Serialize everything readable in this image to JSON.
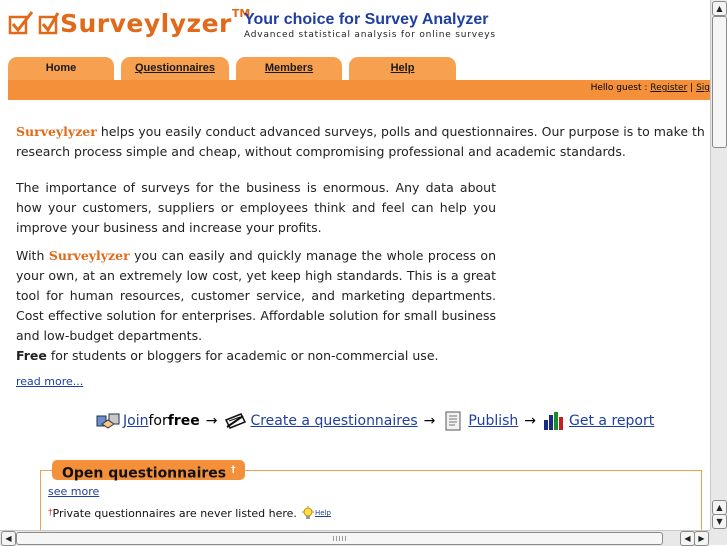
{
  "header": {
    "logo_text": "Surveylyzer",
    "logo_tm": "TM",
    "tagline_title": "Your choice for Survey Analyzer",
    "tagline_sub": "Advanced statistical analysis for online surveys"
  },
  "tabs": [
    {
      "label": "Home"
    },
    {
      "label": "Questionnaires"
    },
    {
      "label": "Members"
    },
    {
      "label": "Help"
    }
  ],
  "navbar": {
    "hello": "Hello guest : ",
    "register": "Register",
    "sep": " | ",
    "signin": "Sig"
  },
  "content": {
    "brand": "Surveylyzer",
    "p1_rest": " helps you easily conduct advanced surveys, polls and questionnaires. Our purpose is to make th",
    "p1_line2": "research process simple and cheap, without compromising professional and academic standards.",
    "p2": "The importance of surveys for the business is enormous. Any data about how your customers, suppliers or employees think and feel can help you improve your business and increase your profits.",
    "p3_start": "With ",
    "p3_rest": " you can easily and quickly manage the whole process on your own, at an extremely low cost, yet keep high standards. This is a great tool for human resources, customer service, and marketing departments. Cost effective solution for enterprises. Affordable solution for small business and low-budget departments.",
    "free_bold": "Free",
    "free_rest": " for students or bloggers for academic or non-commercial use.",
    "read_more": "read more..."
  },
  "steps": {
    "join": "Join",
    "for": " for ",
    "free": "free",
    "arrow": "→",
    "create": "Create a questionnaires",
    "publish": "Publish",
    "report": "Get a report",
    "icons": [
      "handshake-icon",
      "pencil-icon",
      "document-icon",
      "bar-chart-icon"
    ]
  },
  "open_questionnaires": {
    "title": "Open questionnaires",
    "dagger": "†",
    "see_more": "see more",
    "note": "Private questionnaires are never listed here.",
    "help": "Help"
  },
  "colors": {
    "orange": "#f5903a",
    "tab": "#f7a04f",
    "brand": "#e06a1a",
    "link": "#1f3fa0"
  }
}
